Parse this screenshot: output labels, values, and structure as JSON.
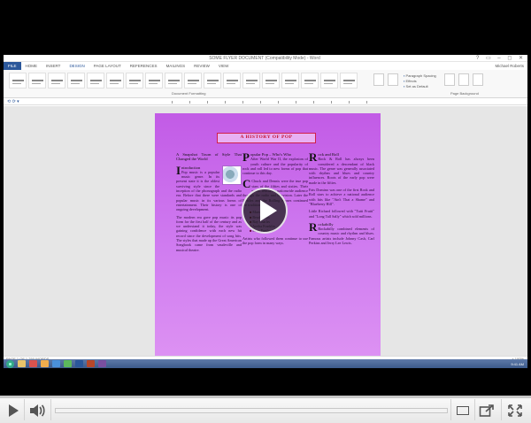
{
  "window": {
    "title": "SOME FLYER DOCUMENT (Compatibility Mode) - Word",
    "controls": "? ▭ – ◻ ✕"
  },
  "ribbon": {
    "tabs": [
      "FILE",
      "HOME",
      "INSERT",
      "DESIGN",
      "PAGE LAYOUT",
      "REFERENCES",
      "MAILINGS",
      "REVIEW",
      "VIEW"
    ],
    "active_tab": "DESIGN",
    "user": "Michael Roberts",
    "group_document_formatting": "Document Formatting",
    "group_page_background": "Page Background",
    "paragraph_options": [
      "Paragraph Spacing",
      "Effects",
      "Set as Default"
    ]
  },
  "quick_access": "⟲ ⟳ ▾",
  "document": {
    "heading": "A HISTORY OF POP",
    "col1": {
      "intro": "A Snapshot Tourn of Style That Changed the World",
      "dropcap": "I",
      "section_title": "ntroduction",
      "p1": "Pop music is a popular music genre. In its present state it is the oldest surviving style since the inception of the phonograph and the radio era. Before that there were standards and popular music in its various forms of entertainment. Their history is one of ongoing development.",
      "p2": "The modern era gave pop music its pop form for the first half of the century and as we understand it today, the style was gaining confidence with each new hit record since the development of song hits. The styles that made up the Great American Songbook came from vaudeville and musical theatre."
    },
    "col2": {
      "dropcap": "P",
      "section_title": "opular Pop – Who's Who",
      "p1": "After World War II, the explosion of youth culture and the popularity of rock and roll led to new forms of pop that continue to this day.",
      "dropcap2": "C",
      "p2": "Chuck and Dennis were the true pop stars of the fifties and sixties. Their music reached a nationwide audience through the radio and television. Later the Beatles and the Rolling Stones continued the tradition.",
      "list": [
        "Marvin Gaye",
        "Beach Boys",
        "Ray Charles",
        "Aretha Franklin",
        "Elvis Presley"
      ],
      "p3": "Artists who followed them continue to use the pop form in many ways."
    },
    "col3": {
      "dropcap": "R",
      "section_title": "ock and Roll",
      "p1": "Rock & Roll has always been considered a descendant of black music. The genre was generally associated with rhythm and blues and country influences. Roots of the early pop were made in the fifties.",
      "p2": "Fats Domino was one of the first Rock and Roll stars to achieve a national audience with hits like \"Ain't That a Shame\" and \"Blueberry Hill\".",
      "p3": "Little Richard followed with \"Tutti Frutti\" and \"Long Tall Sally\" which sold millions.",
      "dropcap2": "R",
      "section_title2": "ockabilly",
      "p4": "Rockabilly combined elements of country music and rhythm and blues. Famous artists include Johnny Cash, Carl Perkins and Jerry Lee Lewis."
    }
  },
  "status": {
    "left": "PAGE 1 OF 1   250 WORDS",
    "right": "—— + 100%"
  },
  "taskbar": {
    "clock": "9:41 AM"
  },
  "player": {
    "progress": 0.0
  }
}
